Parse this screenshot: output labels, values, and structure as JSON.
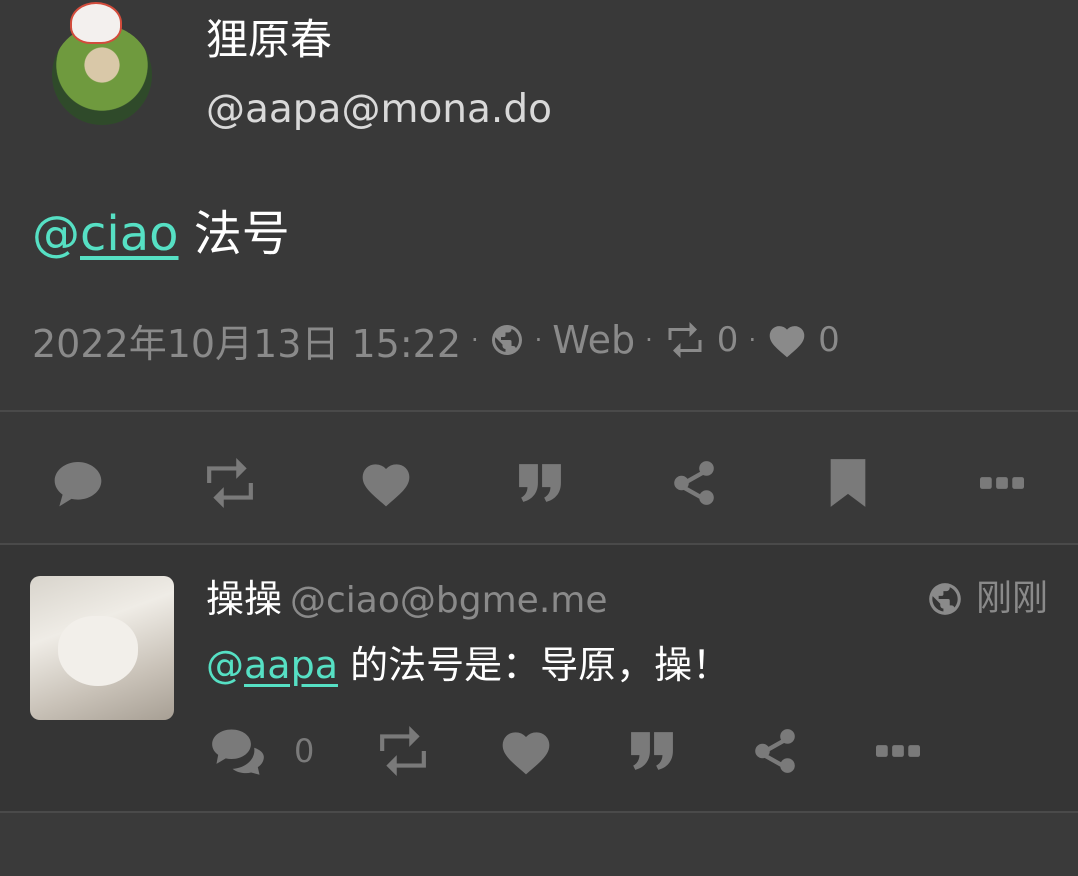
{
  "status": {
    "display_name": "狸原春",
    "acct": "@aapa@mona.do",
    "mention": "ciao",
    "mention_at": "@",
    "text": " 法号",
    "timestamp": "2022年10月13日 15:22",
    "visibility_icon": "globe-icon",
    "application": "Web",
    "reblogs_count": "0",
    "favourites_count": "0",
    "meta_separator": "·"
  },
  "actions": [
    {
      "icon": "reply-icon"
    },
    {
      "icon": "boost-icon"
    },
    {
      "icon": "favourite-icon"
    },
    {
      "icon": "quote-icon"
    },
    {
      "icon": "share-icon"
    },
    {
      "icon": "bookmark-icon"
    },
    {
      "icon": "more-icon"
    }
  ],
  "reply": {
    "display_name": "操操",
    "acct": "@ciao@bgme.me",
    "time": "刚刚",
    "mention_at": "@",
    "mention": "aapa",
    "text": " 的法号是：导原，操！",
    "replies_count": "0"
  },
  "colors": {
    "background": "#393939",
    "accent_mention": "#56e0c4",
    "muted_text": "#8a8a8a",
    "icon_gray": "#7a7a7a"
  }
}
